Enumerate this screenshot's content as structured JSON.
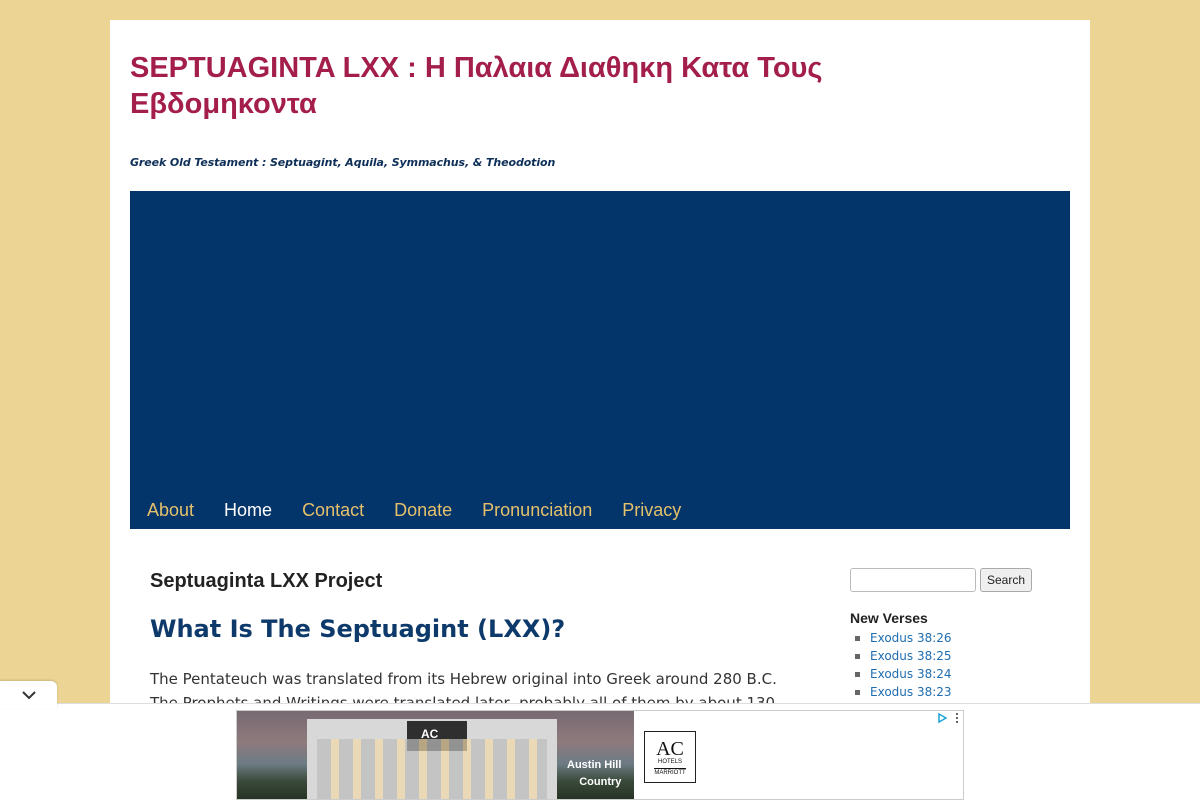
{
  "site": {
    "title": "SEPTUAGINTA LXX : Η Παλαια Διαθηκη Κατα Τους Εβδομηκοντα",
    "description": "Greek Old Testament : Septuagint, Aquila, Symmachus, & Theodotion"
  },
  "nav": {
    "items": [
      {
        "label": "About"
      },
      {
        "label": "Home"
      },
      {
        "label": "Contact"
      },
      {
        "label": "Donate"
      },
      {
        "label": "Pronunciation"
      },
      {
        "label": "Privacy"
      }
    ],
    "current": "Home"
  },
  "main": {
    "entry_title": "Septuaginta LXX Project",
    "heading": "What Is The Septuagint (LXX)?",
    "paragraph": "The Pentateuch was translated from its Hebrew original into Greek around 280 B.C. The Prophets and Writings were translated later, probably all of them by about 130"
  },
  "sidebar": {
    "search": {
      "placeholder": "",
      "button_label": "Search"
    },
    "new_verses": {
      "title": "New Verses",
      "items": [
        "Exodus 38:26",
        "Exodus 38:25",
        "Exodus 38:24",
        "Exodus 38:23"
      ]
    }
  },
  "ad": {
    "caption_line1": "Austin Hill",
    "caption_line2": "Country",
    "hotel_sign": "AC",
    "logo_main": "AC",
    "logo_sub": "HOTELS",
    "logo_brand": "MARRIOTT"
  },
  "colors": {
    "page_bg": "#ecd594",
    "title": "#a31e4b",
    "banner": "#03346a",
    "nav_link": "#e5c16b",
    "link": "#1f6db0"
  }
}
